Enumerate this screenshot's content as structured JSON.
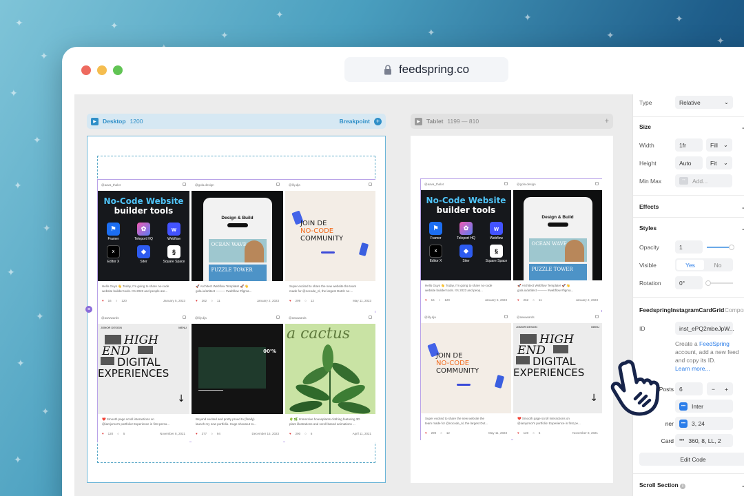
{
  "browser": {
    "url": "feedspring.co"
  },
  "breakpoints": {
    "desktop": {
      "name": "Desktop",
      "size": "1200",
      "action": "Breakpoint"
    },
    "tablet": {
      "name": "Tablet",
      "size": "1199 — 810"
    }
  },
  "posts": [
    {
      "handle": "@aava_thalot",
      "caption1": "Hello Guys 👋 Today, I'm going to share no-code",
      "caption2": "website builder tools. It's 2023 and people are...",
      "likes": "16",
      "comments": "120",
      "date": "January 5, 2023",
      "art": {
        "t1": "No-Code Website",
        "t2": "builder tools",
        "tools": [
          "Framer",
          "Teleport HQ",
          "Webflow",
          "Editor X",
          "Siter",
          "Square Space"
        ]
      }
    },
    {
      "handle": "@gola.design",
      "caption1": "🚀 Architect Webflow Template! 🚀 👋",
      "caption2": "gola.io/artitect ——— #webflow #figma...",
      "likes": "262",
      "comments": "11",
      "date": "January 2, 2023",
      "art": {
        "title1": "Design & Build",
        "ocean": "OCEAN WAVE",
        "puzzle": "PUZZLE TOWER"
      }
    },
    {
      "handle": "@lily.dja",
      "caption1": "Super excited to share the new website the team",
      "caption2": "made for @nocode_nl, the largest Dutch no-...",
      "likes": "299",
      "comments": "12",
      "date": "May 11, 2023",
      "art": {
        "l1": "JOIN DE",
        "l2": "NO-CODE",
        "l3": "COMMUNITY"
      }
    },
    {
      "handle": "@awwwards",
      "caption1": "❤️ Smooth page scroll interactions on",
      "caption2": "@iamjomor's portfolio! Experience in first perso...",
      "likes": "120",
      "comments": "5",
      "date": "November 8, 2021",
      "art": {
        "l1": "HIGH",
        "l2": "END",
        "l3": "DIGITAL",
        "l4": "EXPERIENCES",
        "topl": "JOMOR DESIGN",
        "topr": "MENU"
      }
    },
    {
      "handle": "@lily.dja",
      "caption1": "Beyond excited and pretty proud to (finally)",
      "caption2": "launch my new portfolio. Huge shoutout to...",
      "likes": "377",
      "comments": "94",
      "date": "December 15, 2023",
      "art": {
        "year": "00'%"
      }
    },
    {
      "handle": "@awwwards",
      "caption1": "🌵 🌿 Immersive houseplants clothing featuring 3D",
      "caption2": "plant illustrations and scroll-based animations ...",
      "likes": "290",
      "comments": "6",
      "date": "April 11, 2021",
      "art": {
        "text": "a cactus"
      }
    }
  ],
  "tablet_posts": [
    {
      "handle": "@aava_thalot",
      "caption1": "Hello Guys 👋 Today, I'm going to share no-code",
      "caption2": "website builder tools. It's 2023 and peop...",
      "likes": "16",
      "comments": "120",
      "date": "January 5, 2023"
    },
    {
      "handle": "@gola.design",
      "caption1": "🚀 Architect Webflow Template! 🚀 👋",
      "caption2": "gola.io/artitect ——— #webflow #figma...",
      "likes": "262",
      "comments": "11",
      "date": "January 2, 2023"
    },
    {
      "handle": "@lily.dja",
      "caption1": "Super excited to share the new website the",
      "caption2": "team made for @nocode_nl, the largest Dut...",
      "likes": "299",
      "comments": "12",
      "date": "May 11, 2023"
    },
    {
      "handle": "@awwwards",
      "caption1": "❤️ Smooth page scroll interactions on",
      "caption2": "@iamjomor's portfolio! Experience in first pe...",
      "likes": "120",
      "comments": "5",
      "date": "November 8, 2021"
    }
  ],
  "panel": {
    "type_label": "Type",
    "type_value": "Relative",
    "size_section": "Size",
    "width_label": "Width",
    "width_value": "1fr",
    "width_mode": "Fill",
    "height_label": "Height",
    "height_value": "Auto",
    "height_mode": "Fit",
    "minmax_label": "Min Max",
    "minmax_placeholder": "Add...",
    "effects_section": "Effects",
    "styles_section": "Styles",
    "opacity_label": "Opacity",
    "opacity_value": "1",
    "visible_label": "Visible",
    "visible_yes": "Yes",
    "visible_no": "No",
    "rotation_label": "Rotation",
    "rotation_value": "0°",
    "component_title": "FeedspringInstagramCardGrid",
    "component_tag": "Compon",
    "id_label": "ID",
    "id_value": "inst_ePQ2mbeJpW...",
    "help_text1": "Create a ",
    "help_link": "FeedSpring",
    "help_text2": " account, add a new feed and copy its ID.",
    "learn_more": "Learn more...",
    "posts_label": "Posts",
    "posts_value": "6",
    "font_value": "Inter",
    "grid_label": "ner",
    "grid_value": "3, 24",
    "card_label": "Card",
    "card_value": "360, 8, LL, 2",
    "edit_code": "Edit Code",
    "scroll_section": "Scroll Section"
  }
}
